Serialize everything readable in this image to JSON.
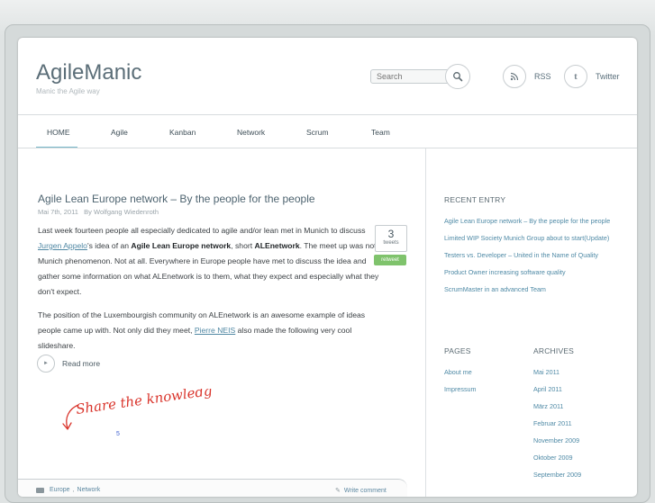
{
  "site": {
    "title": "AgileManic",
    "tagline": "Manic the Agile way",
    "search_placeholder": "Search",
    "social": {
      "rss": "RSS",
      "twitter": "Twitter"
    }
  },
  "nav": {
    "items": [
      {
        "label": "HOME",
        "active": true
      },
      {
        "label": "Agile"
      },
      {
        "label": "Kanban"
      },
      {
        "label": "Network"
      },
      {
        "label": "Scrum"
      },
      {
        "label": "Team"
      }
    ]
  },
  "post": {
    "title": "Agile Lean Europe network – By the people for the people",
    "date": "Mai 7th, 2011",
    "author_prefix": "By",
    "author": "Wolfgang Wiedenroth",
    "p1": {
      "t1": "Last week fourteen people all especially dedicated to agile and/or lean met in Munich to discuss ",
      "link1": "Jurgen Appelo",
      "t2": "'s idea of an ",
      "bold1": "Agile Lean Europe network",
      "t3": ", short ",
      "bold2": "ALEnetwork",
      "t4": ". The meet up was not a Munich phenomenon. Not at all. Everywhere in Europe people have met to discuss the idea and gather some information on what ALEnetwork is to them, what they expect and especially what they don't expect."
    },
    "p2": {
      "t1": "The position of the Luxembourgish community on ALEnetwork is an awesome example of ideas people came up with. Not only did they meet, ",
      "link1": "Pierre NEIS",
      "t2": " also made the following very cool slideshare."
    },
    "tweet_count": "3",
    "tweet_label": "tweets",
    "retweet_label": "retweet",
    "read_more": "Read more",
    "share_text": "Share the knowledge!",
    "tiny_link": "5",
    "categories": [
      "Europe",
      "Network"
    ],
    "write_comment": "Write comment"
  },
  "sidebar": {
    "recent_heading": "RECENT ENTRY",
    "recent": [
      "Agile Lean Europe network – By the people for the people",
      "Limited WIP Society Munich Group about to start(Update)",
      "Testers vs. Developer – United in the Name of Quality",
      "Product Owner increasing software quality",
      "ScrumMaster in an advanced Team"
    ],
    "pages_heading": "PAGES",
    "pages": [
      "About me",
      "Impressum"
    ],
    "archives_heading": "ARCHIVES",
    "archives": [
      "Mai 2011",
      "April 2011",
      "März 2011",
      "Februar 2011",
      "November 2009",
      "Oktober 2009",
      "September 2009"
    ]
  },
  "colors": {
    "accent": "#77b6c8",
    "link": "#4f87a3",
    "retweet": "#7fc36c",
    "share_red": "#d9342b"
  }
}
